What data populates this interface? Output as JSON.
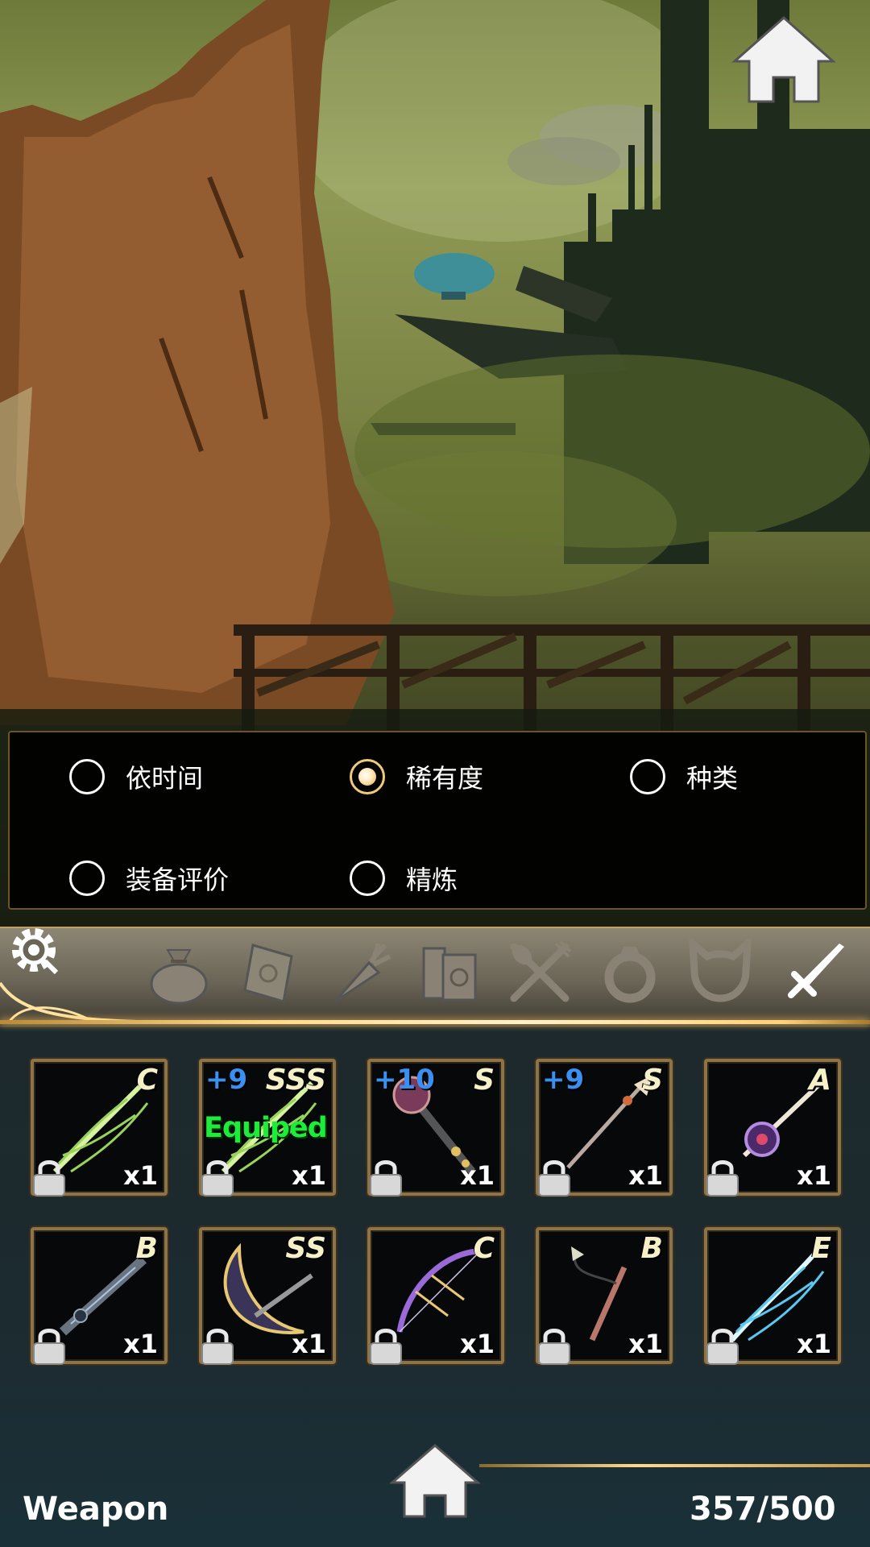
{
  "sort_options": [
    {
      "label": "依时间",
      "checked": false
    },
    {
      "label": "稀有度",
      "checked": true
    },
    {
      "label": "种类",
      "checked": false
    },
    {
      "label": "装备评价",
      "checked": false
    },
    {
      "label": "精炼",
      "checked": false
    }
  ],
  "categories": [
    {
      "icon": "bag-icon"
    },
    {
      "icon": "card-icon"
    },
    {
      "icon": "carrot-icon"
    },
    {
      "icon": "books-icon"
    },
    {
      "icon": "spoon-fork-icon"
    },
    {
      "icon": "ring-icon"
    },
    {
      "icon": "cat-ears-icon"
    },
    {
      "icon": "sword-icon",
      "active": true
    }
  ],
  "items": [
    {
      "grade": "C",
      "refine": "",
      "equipped": "",
      "qty": "x1",
      "art": "green-plume"
    },
    {
      "grade": "SSS",
      "refine": "+9",
      "equipped": "Equiped",
      "qty": "x1",
      "art": "green-plume"
    },
    {
      "grade": "S",
      "refine": "+10",
      "equipped": "",
      "qty": "x1",
      "art": "mace"
    },
    {
      "grade": "S",
      "refine": "+9",
      "equipped": "",
      "qty": "x1",
      "art": "spear"
    },
    {
      "grade": "A",
      "refine": "",
      "equipped": "",
      "qty": "x1",
      "art": "purple-staff"
    },
    {
      "grade": "B",
      "refine": "",
      "equipped": "",
      "qty": "x1",
      "art": "gun-blade"
    },
    {
      "grade": "SS",
      "refine": "",
      "equipped": "",
      "qty": "x1",
      "art": "scythe"
    },
    {
      "grade": "C",
      "refine": "",
      "equipped": "",
      "qty": "x1",
      "art": "bow"
    },
    {
      "grade": "B",
      "refine": "",
      "equipped": "",
      "qty": "x1",
      "art": "whip"
    },
    {
      "grade": "E",
      "refine": "",
      "equipped": "",
      "qty": "x1",
      "art": "blue-plume"
    }
  ],
  "footer": {
    "category_name": "Weapon",
    "capacity": "357/500"
  },
  "colors": {
    "gold": "#ffd98a",
    "refine_blue": "#3a8ff0",
    "equipped_green": "#1eeb3a"
  }
}
